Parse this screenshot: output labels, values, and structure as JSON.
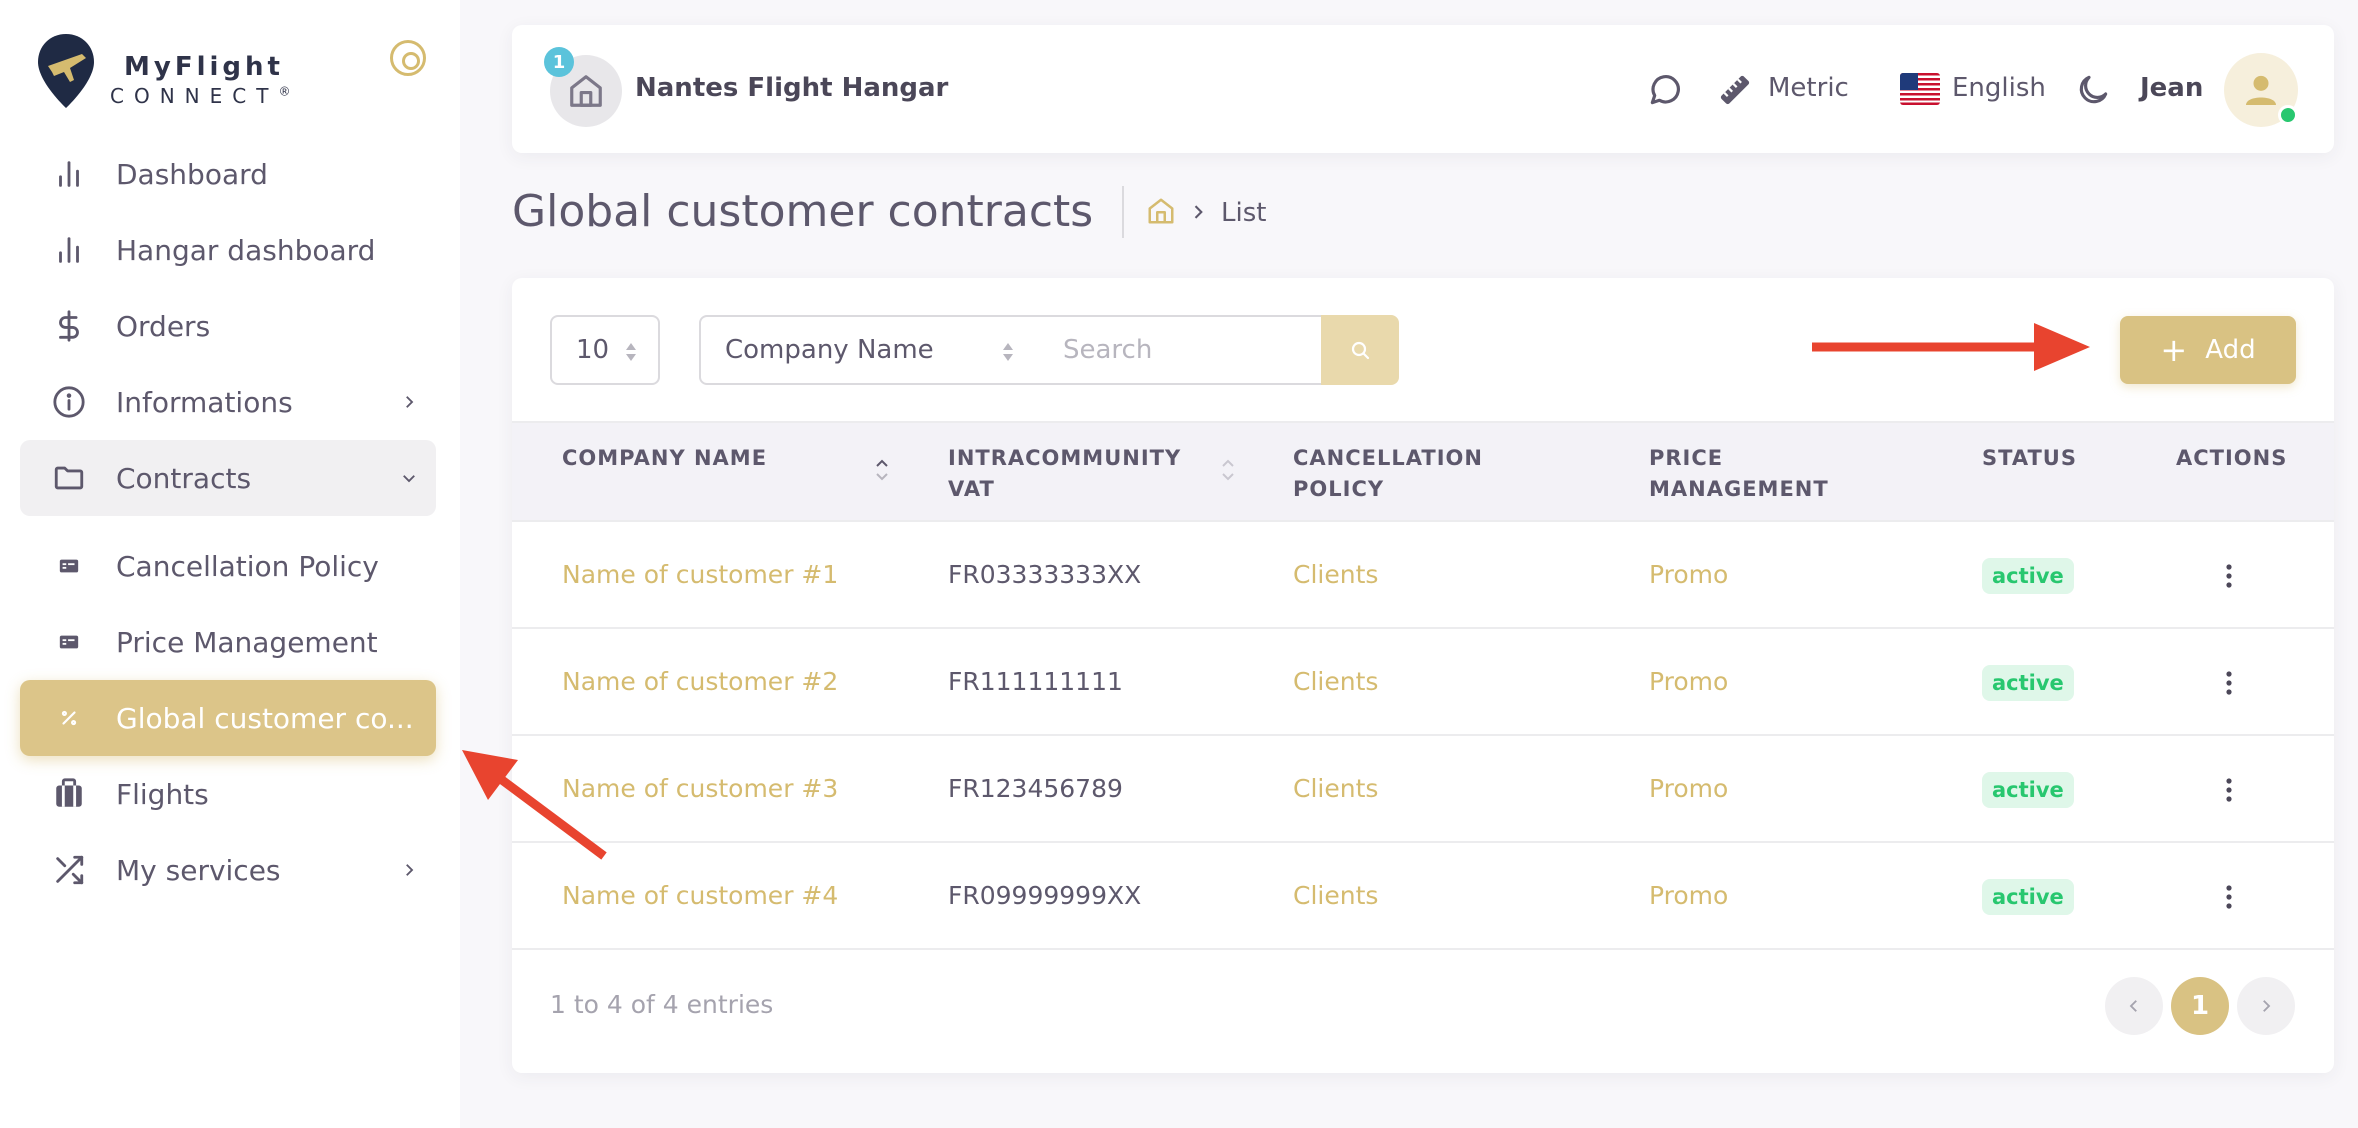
{
  "brand": {
    "line1": "MyFlight",
    "line2": "CONNECT",
    "reg": "®"
  },
  "sidebar": {
    "items": [
      {
        "label": "Dashboard",
        "icon": "bar-chart-icon"
      },
      {
        "label": "Hangar dashboard",
        "icon": "bar-chart-icon"
      },
      {
        "label": "Orders",
        "icon": "dollar-icon"
      },
      {
        "label": "Informations",
        "icon": "info-circle-icon"
      },
      {
        "label": "Contracts",
        "icon": "folder-icon"
      },
      {
        "label": "Cancellation Policy",
        "icon": "id-card-icon"
      },
      {
        "label": "Price Management",
        "icon": "id-card-icon"
      },
      {
        "label": "Global customer co...",
        "icon": "percent-icon"
      },
      {
        "label": "Flights",
        "icon": "luggage-icon"
      },
      {
        "label": "My services",
        "icon": "shuffle-icon"
      }
    ]
  },
  "topbar": {
    "hangar_badge": "1",
    "hangar_name": "Nantes Flight Hangar",
    "unit_label": "Metric",
    "language_label": "English",
    "user_name": "Jean"
  },
  "page": {
    "title": "Global customer contracts",
    "breadcrumb_current": "List"
  },
  "table_controls": {
    "per_page": "10",
    "filter_field": "Company Name",
    "search_placeholder": "Search",
    "add_label": "Add"
  },
  "table": {
    "headers": {
      "company": "COMPANY NAME",
      "vat_line1": "INTRACOMMUNITY",
      "vat_line2": "VAT",
      "cancel_line1": "CANCELLATION",
      "cancel_line2": "POLICY",
      "price_line1": "PRICE",
      "price_line2": "MANAGEMENT",
      "status": "STATUS",
      "actions": "ACTIONS"
    },
    "rows": [
      {
        "company": "Name of customer #1",
        "vat": "FR03333333XX",
        "cancellation": "Clients",
        "price": "Promo",
        "status": "active"
      },
      {
        "company": "Name of customer #2",
        "vat": "FR111111111",
        "cancellation": "Clients",
        "price": "Promo",
        "status": "active"
      },
      {
        "company": "Name of customer #3",
        "vat": "FR123456789",
        "cancellation": "Clients",
        "price": "Promo",
        "status": "active"
      },
      {
        "company": "Name of customer #4",
        "vat": "FR09999999XX",
        "cancellation": "Clients",
        "price": "Promo",
        "status": "active"
      }
    ]
  },
  "footer": {
    "entries_text": "1 to 4 of 4 entries",
    "current_page": "1"
  },
  "colors": {
    "accent": "#d5bb6f",
    "active_nav": "#dcc589",
    "success": "#28c76f",
    "annotation_arrow": "#e8442f"
  }
}
